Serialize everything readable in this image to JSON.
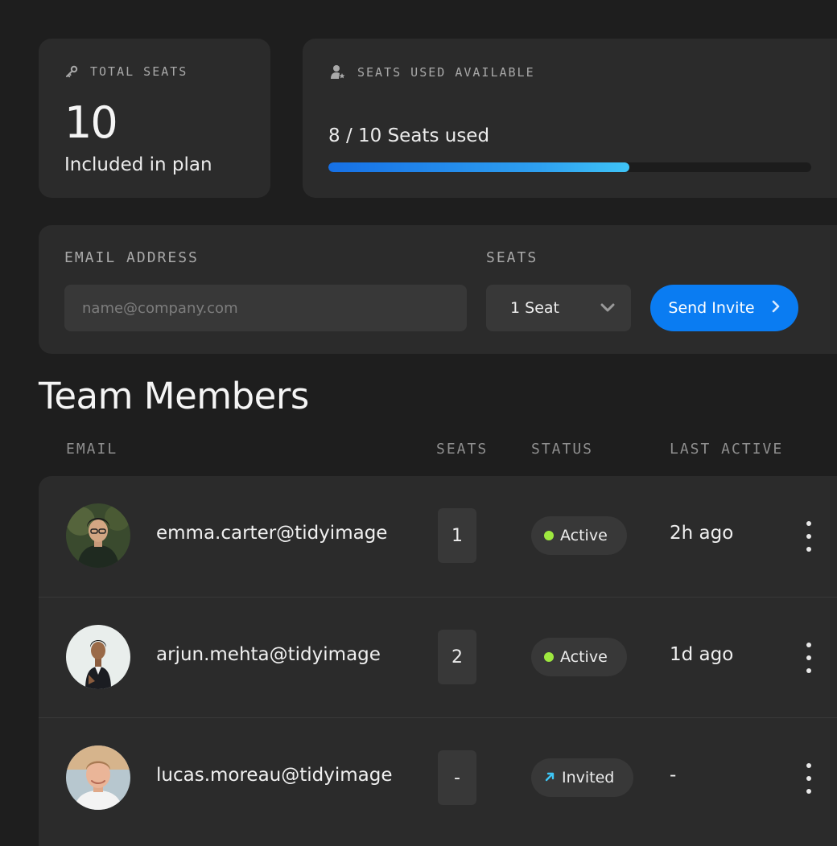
{
  "colors": {
    "background": "#1e1e1e",
    "card": "#2b2b2b",
    "accent": "#0a7cf2",
    "active_dot": "#9ee83f",
    "invited_arrow": "#3ec6f5"
  },
  "stats": {
    "total": {
      "icon": "key-icon",
      "label": "TOTAL SEATS",
      "value": "10",
      "subtitle": "Included in plan"
    },
    "used": {
      "icon": "user-star-icon",
      "label": "SEATS USED AVAILABLE",
      "text": "8 / 10 Seats used",
      "used": 8,
      "total": 10
    }
  },
  "invite": {
    "email_label": "EMAIL ADDRESS",
    "email_placeholder": "name@company.com",
    "email_value": "",
    "seats_label": "SEATS",
    "seats_selected": "1 Seat",
    "button_label": "Send Invite"
  },
  "team": {
    "title": "Team Members",
    "columns": {
      "email": "EMAIL",
      "seats": "SEATS",
      "status": "STATUS",
      "last_active": "LAST ACTIVE"
    },
    "members": [
      {
        "email": "emma.carter@tidyimage",
        "seats": "1",
        "status": "Active",
        "status_icon": "status-dot-icon",
        "last_active": "2h ago"
      },
      {
        "email": "arjun.mehta@tidyimage",
        "seats": "2",
        "status": "Active",
        "status_icon": "status-dot-icon",
        "last_active": "1d ago"
      },
      {
        "email": "lucas.moreau@tidyimage",
        "seats": "-",
        "status": "Invited",
        "status_icon": "arrow-up-right-icon",
        "last_active": "-"
      }
    ]
  }
}
